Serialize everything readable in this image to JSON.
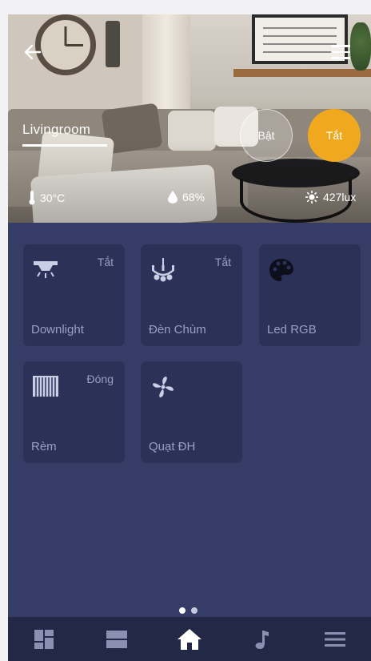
{
  "header": {
    "room_name": "Livingroom",
    "button_on": "Bật",
    "button_off": "Tắt"
  },
  "sensors": {
    "temperature": "30°C",
    "humidity": "68%",
    "light": "427lux"
  },
  "devices": [
    {
      "label": "Downlight",
      "state": "Tắt",
      "icon": "downlight-icon"
    },
    {
      "label": "Đèn Chùm",
      "state": "Tắt",
      "icon": "chandelier-icon"
    },
    {
      "label": "Led RGB",
      "state": "",
      "icon": "palette-icon"
    },
    {
      "label": "Rèm",
      "state": "Đóng",
      "icon": "curtain-icon"
    },
    {
      "label": "Quạt ĐH",
      "state": "",
      "icon": "fan-icon"
    }
  ],
  "pagination": {
    "pages": 2,
    "active": 1
  },
  "bottom_nav": [
    {
      "icon": "dashboard-icon"
    },
    {
      "icon": "rooms-icon"
    },
    {
      "icon": "home-icon",
      "active": true
    },
    {
      "icon": "music-icon"
    },
    {
      "icon": "menu-icon"
    }
  ],
  "colors": {
    "background": "#353c66",
    "tile": "#2c3157",
    "accent_off_button": "#f0a81e",
    "nav_bar": "#222845",
    "tile_text": "#9aa0c4"
  }
}
